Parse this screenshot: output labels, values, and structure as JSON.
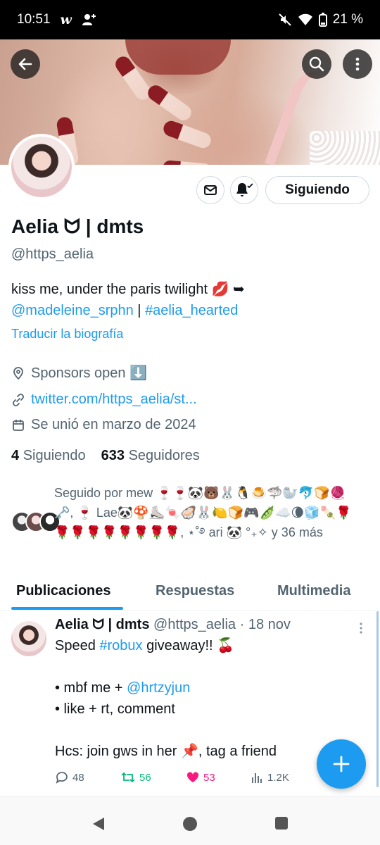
{
  "status_bar": {
    "time": "10:51",
    "app_badge": "w",
    "battery": "21 %"
  },
  "profile": {
    "display_name": "Aelia ᗢ | dmts",
    "handle": "@https_aelia",
    "bio_text": "kiss me, under the paris twilight 💋  ➥",
    "bio_mention": "@madeleine_srphn",
    "bio_separator": " | ",
    "bio_hashtag": "#aelia_hearted",
    "translate_label": "Traducir la biografía",
    "location": "Sponsors open ⬇️",
    "website": "twitter.com/https_aelia/st...",
    "joined": "Se unió en marzo de 2024",
    "following_count": "4",
    "following_label": "Siguiendo",
    "followers_count": "633",
    "followers_label": "Seguidores",
    "followed_by": "Seguido por mew 🍷🍷🐼🐻🐰🐧🍮🦈🦭🐬🍞🧶🗝️, 🍷 Lae🐼🍄⛸️🍬🦪🐰🍋🍞🎮🫛☁️🌘🧊🍡🌹🌹🌹🌹🌹🌹🌹🌹🌹, ⋆˚࿔ ari 🐼 °₊✧ y 36 más"
  },
  "actions": {
    "follow_label": "Siguiendo"
  },
  "tabs": [
    {
      "label": "Publicaciones",
      "active": true
    },
    {
      "label": "Respuestas",
      "active": false
    },
    {
      "label": "Multimedia",
      "active": false
    }
  ],
  "post": {
    "name": "Aelia ᗢ | dmts",
    "meta": "@https_aelia · 18 nov",
    "line1_prefix": "Speed ",
    "line1_hashtag": "#robux",
    "line1_suffix": " giveaway!! 🍒",
    "line2_prefix": "• mbf me + ",
    "line2_mention": "@hrtzyjun",
    "line3": "• like + rt, comment",
    "line4": "Hcs: join gws in her 📌, tag a friend",
    "replies": "48",
    "reposts": "56",
    "likes": "53",
    "views": "1.2K"
  },
  "colors": {
    "accent": "#1d9bf0",
    "repost": "#00ba7c",
    "like": "#f91880",
    "secondary": "#536471"
  }
}
